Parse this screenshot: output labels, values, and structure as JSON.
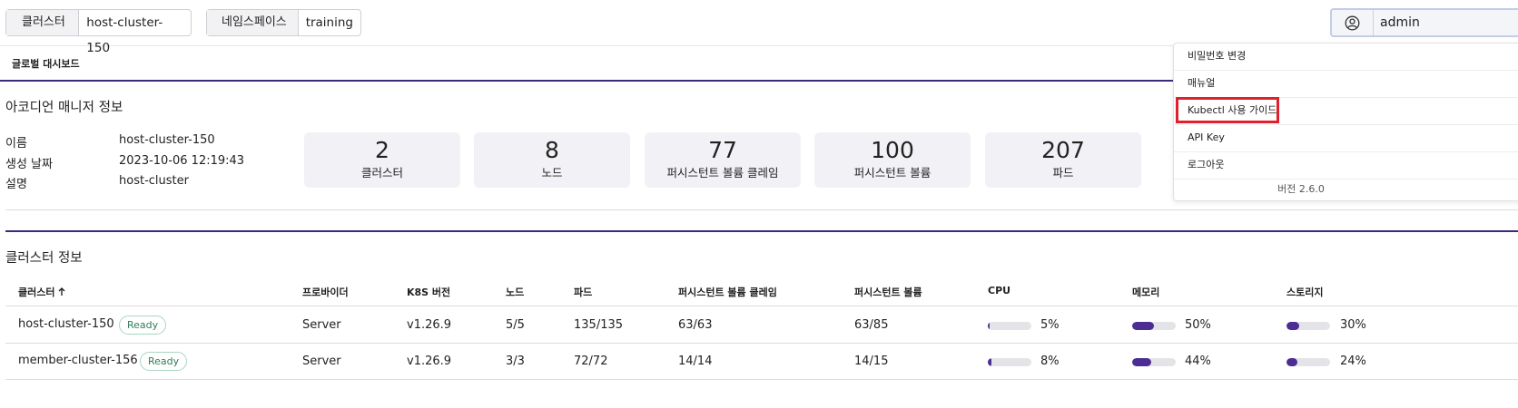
{
  "header": {
    "cluster_label": "클러스터",
    "cluster_value": "host-cluster-150",
    "namespace_label": "네임스페이스",
    "namespace_value": "training",
    "user_name": "admin",
    "user_icon": "user-circle-icon"
  },
  "tabs": {
    "global_dashboard": "글로벌 대시보드"
  },
  "manager": {
    "title": "아코디언 매니저 정보",
    "name_label": "이름",
    "name_value": "host-cluster-150",
    "created_label": "생성 날짜",
    "created_value": "2023-10-06 12:19:43",
    "desc_label": "설명",
    "desc_value": "host-cluster"
  },
  "stats": [
    {
      "value": "2",
      "label": "클러스터"
    },
    {
      "value": "8",
      "label": "노드"
    },
    {
      "value": "77",
      "label": "퍼시스턴트 볼륨 클레임"
    },
    {
      "value": "100",
      "label": "퍼시스턴트 볼륨"
    },
    {
      "value": "207",
      "label": "파드"
    }
  ],
  "cluster_info": {
    "title": "클러스터 정보",
    "columns": {
      "cluster": "클러스터",
      "provider": "프로바이더",
      "k8s": "K8S 버전",
      "node": "노드",
      "pod": "파드",
      "pvc": "퍼시스턴트 볼륨 클레임",
      "pv": "퍼시스턴트 볼륨",
      "cpu": "CPU",
      "memory": "메모리",
      "storage": "스토리지"
    },
    "sort_icon": "arrow-up-icon",
    "rows": [
      {
        "name": "host-cluster-150",
        "status": "Ready",
        "provider": "Server",
        "k8s": "v1.26.9",
        "node": "5/5",
        "pod": "135/135",
        "pvc": "63/63",
        "pv": "63/85",
        "cpu": "5%",
        "cpu_level": 0.05,
        "memory": "50%",
        "memory_level": 0.5,
        "storage": "30%",
        "storage_level": 0.3
      },
      {
        "name": "member-cluster-156",
        "status": "Ready",
        "provider": "Server",
        "k8s": "v1.26.9",
        "node": "3/3",
        "pod": "72/72",
        "pvc": "14/14",
        "pv": "14/15",
        "cpu": "8%",
        "cpu_level": 0.08,
        "memory": "44%",
        "memory_level": 0.44,
        "storage": "24%",
        "storage_level": 0.24
      }
    ]
  },
  "user_menu": {
    "items": [
      "비밀번호 변경",
      "매뉴얼",
      "Kubectl 사용 가이드",
      "API Key",
      "로그아웃"
    ],
    "version": "버전 2.6.0"
  },
  "colors": {
    "accent": "#4b2d94",
    "highlight": "#e0202a",
    "ready": "#2e7d5b"
  }
}
